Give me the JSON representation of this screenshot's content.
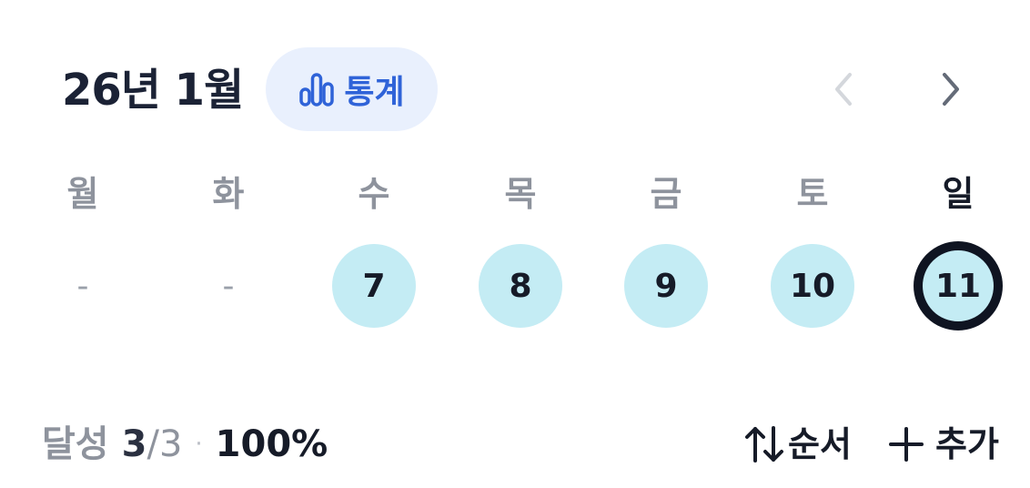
{
  "header": {
    "month_title": "26년 1월",
    "stats_label": "통계"
  },
  "weekdays": [
    "월",
    "화",
    "수",
    "목",
    "금",
    "토",
    "일"
  ],
  "days": [
    "-",
    "-",
    "7",
    "8",
    "9",
    "10",
    "11"
  ],
  "footer": {
    "achieved_label": "달성",
    "achieved_done": "3",
    "achieved_slash": "/",
    "achieved_total": "3",
    "separator": "·",
    "percent": "100%",
    "order_label": "순서",
    "add_label": "추가"
  },
  "colors": {
    "accent": "#2f63d8",
    "stats_bg": "#e9f0fd",
    "done_circle": "#c4ecf4",
    "today_ring": "#0f1421"
  },
  "icons": {
    "stats": "bar-chart-icon",
    "prev": "chevron-left-icon",
    "next": "chevron-right-icon",
    "order": "sort-arrows-icon",
    "add": "plus-icon"
  }
}
